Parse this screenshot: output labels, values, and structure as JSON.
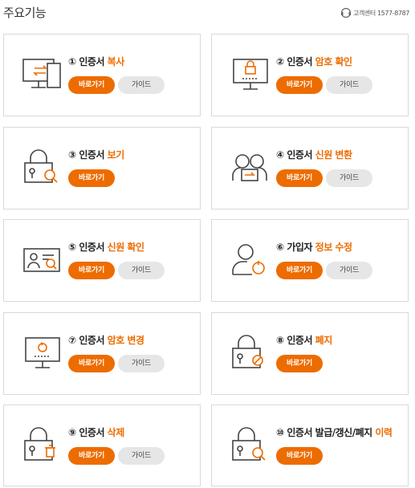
{
  "page_title": "주요기능",
  "customer_center": "고객센터 1577-8787",
  "colors": {
    "accent": "#ed6c00",
    "guide_bg": "#e6e6e6",
    "border": "#d9d9d9"
  },
  "cards": [
    {
      "num": "①",
      "title_plain": "인증서",
      "title_highlight": "복사",
      "icon": "monitor-transfer-icon",
      "go_label": "바로가기",
      "guide_label": "가이드"
    },
    {
      "num": "②",
      "title_plain": "인증서",
      "title_highlight": "암호 확인",
      "icon": "monitor-lock-icon",
      "go_label": "바로가기",
      "guide_label": "가이드"
    },
    {
      "num": "③",
      "title_plain": "인증서",
      "title_highlight": "보기",
      "icon": "certificate-search-icon",
      "go_label": "바로가기"
    },
    {
      "num": "④",
      "title_plain": "인증서",
      "title_highlight": "신원 변환",
      "icon": "users-exchange-icon",
      "go_label": "바로가기",
      "guide_label": "가이드"
    },
    {
      "num": "⑤",
      "title_plain": "인증서",
      "title_highlight": "신원 확인",
      "icon": "id-card-search-icon",
      "go_label": "바로가기",
      "guide_label": "가이드"
    },
    {
      "num": "⑥",
      "title_plain": "가입자",
      "title_highlight": "정보 수정",
      "icon": "user-refresh-icon",
      "go_label": "바로가기",
      "guide_label": "가이드"
    },
    {
      "num": "⑦",
      "title_plain": "인증서",
      "title_highlight": "암호 변경",
      "icon": "monitor-refresh-icon",
      "go_label": "바로가기",
      "guide_label": "가이드"
    },
    {
      "num": "⑧",
      "title_plain": "인증서",
      "title_highlight": "폐지",
      "icon": "certificate-revoke-icon",
      "go_label": "바로가기"
    },
    {
      "num": "⑨",
      "title_plain": "인증서",
      "title_highlight": "삭제",
      "icon": "certificate-delete-icon",
      "go_label": "바로가기",
      "guide_label": "가이드"
    },
    {
      "num": "⑩",
      "title_plain": "인증서 발급/갱신/폐지",
      "title_highlight": "이력",
      "icon": "certificate-history-icon",
      "go_label": "바로가기"
    }
  ]
}
